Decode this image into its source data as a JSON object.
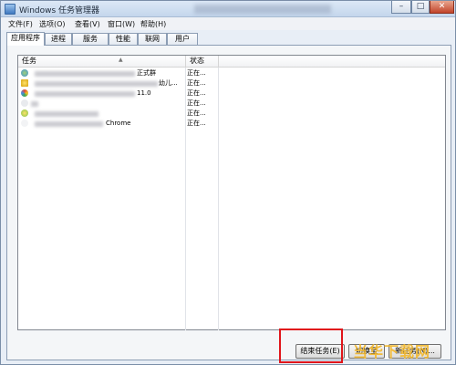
{
  "window": {
    "title": "Windows 任务管理器"
  },
  "menu": [
    "文件(F)",
    "选项(O)",
    "查看(V)",
    "窗口(W)",
    "帮助(H)"
  ],
  "tabs": [
    "应用程序",
    "进程",
    "服务",
    "性能",
    "联网",
    "用户"
  ],
  "active_tab": "应用程序",
  "columns": {
    "task": "任务",
    "status": "状态"
  },
  "rows": [
    {
      "task": "正式群",
      "status": "正在..."
    },
    {
      "task": "幼儿...",
      "status": "正在..."
    },
    {
      "task": "11.0",
      "status": "正在..."
    },
    {
      "task": "",
      "status": "正在..."
    },
    {
      "task": "",
      "status": "正在..."
    },
    {
      "task": "Chrome",
      "status": "正在..."
    }
  ],
  "buttons": {
    "end_task": "结束任务(E)",
    "switch_to": "切换至",
    "new_task": "新任务(N)..."
  },
  "watermark": "当华下载网",
  "colors": {
    "highlight": "#e0151b",
    "title_bg": "#c4d6ec",
    "watermark": "#f2b72b"
  }
}
